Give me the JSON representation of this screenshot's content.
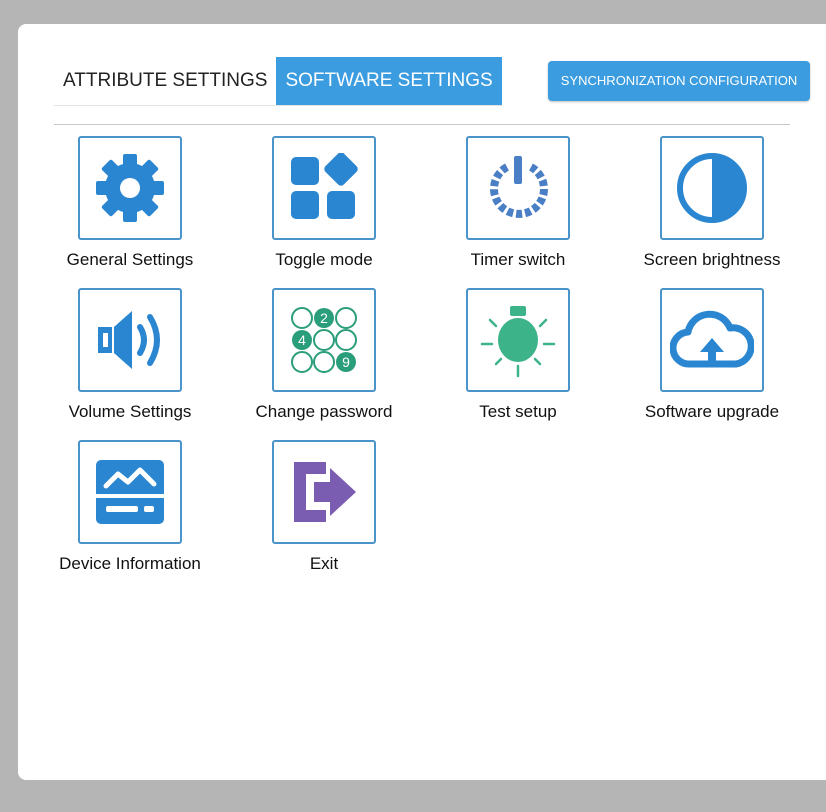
{
  "tabs": [
    {
      "label": "ATTRIBUTE SETTINGS",
      "active": false
    },
    {
      "label": "SOFTWARE SETTINGS",
      "active": true
    }
  ],
  "sync_button": {
    "label": "SYNCHRONIZATION CONFIGURATION"
  },
  "colors": {
    "accent": "#3b9ce0",
    "icon_blue": "#2a86d0",
    "icon_green": "#3db38a",
    "icon_purple": "#7a5cb0"
  },
  "tiles": [
    {
      "label": "General Settings",
      "icon": "gear-icon"
    },
    {
      "label": "Toggle mode",
      "icon": "grid-toggle-icon"
    },
    {
      "label": "Timer switch",
      "icon": "timer-power-icon"
    },
    {
      "label": "Screen brightness",
      "icon": "brightness-half-circle-icon"
    },
    {
      "label": "Volume Settings",
      "icon": "speaker-icon"
    },
    {
      "label": "Change password",
      "icon": "keypad-icon",
      "keypad_digits": [
        "2",
        "4",
        "9"
      ]
    },
    {
      "label": "Test setup",
      "icon": "lightbulb-icon"
    },
    {
      "label": "Software upgrade",
      "icon": "cloud-upload-icon"
    },
    {
      "label": "Device Information",
      "icon": "monitor-chart-icon"
    },
    {
      "label": "Exit",
      "icon": "exit-arrow-icon"
    }
  ]
}
